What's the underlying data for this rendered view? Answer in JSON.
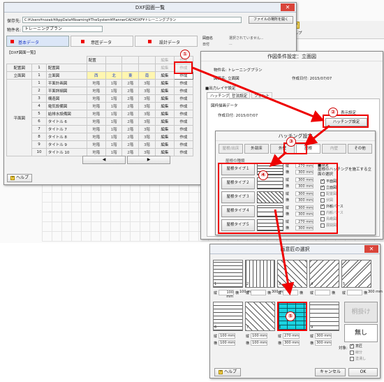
{
  "dxf_window": {
    "title": "DXF図面一覧",
    "save_to_label": "保存先:",
    "save_to_value": "C:¥Users¥nozaki¥AppData¥Roaming¥TheSystem¥PlannerCAD¥DXF¥トレーニングプラン",
    "property_label": "物件名:",
    "property_value": "トレーニングプラン",
    "open_folder_button": "ファイルの場所を開く",
    "tabs": [
      "基本データ",
      "意匠データ",
      "設計データ"
    ],
    "list_title": "【DXF図面一覧】",
    "side_info": {
      "drawing_label": "図面名",
      "drawing_value": "選択されていません...",
      "date_label": "日付",
      "date_value": "..."
    },
    "groups": [
      {
        "name": "配置図",
        "row_no": "1",
        "row_name": "配置図"
      },
      {
        "name": "立面図",
        "row_no": "1",
        "row_name": "立面図"
      }
    ],
    "elevation_headers": [
      "西",
      "北",
      "東",
      "南"
    ],
    "plan_group": "平面図",
    "plan_rows": [
      {
        "no": "1",
        "name": "平面計画図"
      },
      {
        "no": "2",
        "name": "平面詳細図"
      },
      {
        "no": "3",
        "name": "構造図"
      },
      {
        "no": "4",
        "name": "電気設備図"
      },
      {
        "no": "5",
        "name": "給排水設備図"
      },
      {
        "no": "6",
        "name": "タイトル 6"
      },
      {
        "no": "7",
        "name": "タイトル 7"
      },
      {
        "no": "8",
        "name": "タイトル 8"
      },
      {
        "no": "9",
        "name": "タイトル 9"
      },
      {
        "no": "10",
        "name": "タイトル 10"
      }
    ],
    "floor_cells": [
      "地階",
      "1階",
      "2階",
      "3階"
    ],
    "header_placement": "配置",
    "edit_label": "編集",
    "create_label": "作成",
    "prev_label": "◀",
    "next_label": "▶",
    "help_label": "ヘルプ"
  },
  "cad_toolbar": {
    "help": "ヘルプ"
  },
  "condition_window": {
    "title": "作図条件設定：立面図",
    "property_label": "物件名: トレーニングプラン",
    "drawing_label": "図面名: 立面図",
    "created_label": "作成日付: 2015/07/07",
    "output_layer_label": "■出力レイヤ設定",
    "tabs": [
      "ハッチング",
      "寸法設定",
      "フォント"
    ],
    "target_label": "図枠描画データ",
    "target_date": "作成日付: 2015/07/07",
    "display_setting": "表示設定",
    "hatching_button": "ハッチング設定"
  },
  "hatching_window": {
    "title": "ハッチング設定",
    "tabs": [
      "屋根/出床",
      "外部床",
      "外壁",
      "屋根",
      "内壁",
      "その他"
    ],
    "selected_tab": "屋根",
    "group_label": "屋根の種類",
    "types": [
      "屋根タイプ１",
      "屋根タイプ２",
      "屋根タイプ３",
      "屋根タイプ４",
      "屋根タイプ５"
    ],
    "dims": [
      {
        "v": "縦",
        "vv": "270 mm",
        "h": "横",
        "hv": "300 mm"
      },
      {
        "v": "縦",
        "vv": "300 mm",
        "h": "横",
        "hv": "300 mm"
      },
      {
        "v": "縦",
        "vv": "300 mm",
        "h": "横",
        "hv": "300 mm"
      },
      {
        "v": "縦",
        "vv": "300 mm",
        "h": "横",
        "hv": "300 mm"
      },
      {
        "v": "縦",
        "vv": "270 mm",
        "h": "横",
        "hv": "300 mm"
      }
    ],
    "settings_title": "■設定",
    "settings_desc": "屋根のハッチングを施工する立面の選択",
    "options": [
      {
        "label": "平面図",
        "checked": true
      },
      {
        "label": "立面図",
        "checked": true
      },
      {
        "label": "配置図",
        "checked": false
      },
      {
        "label": "伏図",
        "checked": false
      },
      {
        "label": "外観パース",
        "checked": true
      },
      {
        "label": "内観パース",
        "checked": false
      },
      {
        "label": "鳥瞰図",
        "checked": false
      },
      {
        "label": "展開図",
        "checked": false
      }
    ]
  },
  "pattern_window": {
    "title": "画意匠の選択",
    "row1_nums": [
      "1",
      "2",
      "3",
      "4",
      "5"
    ],
    "row1_dims": [
      {
        "v": "100 mm",
        "h": "100 mm"
      },
      {
        "v": "",
        "h": "300 mm"
      },
      {
        "v": "",
        "h": ""
      },
      {
        "v": "",
        "h": ""
      },
      {
        "v": "",
        "h": "300 mm"
      }
    ],
    "row2_nums": [
      "6",
      "7",
      "8",
      "9"
    ],
    "row2_dims": [
      {
        "v": "100 mm",
        "h": "100 mm"
      },
      {
        "v": "100 mm",
        "h": "100 mm"
      },
      {
        "v": "270 mm",
        "h": "300 mm"
      },
      {
        "v": "300 mm",
        "h": "300 mm"
      }
    ],
    "v_label": "縦",
    "h_label": "横",
    "grid_button": "桐掛け",
    "none_button": "無し",
    "target_label": "対象:",
    "target_opts": [
      {
        "label": "意匠",
        "checked": true
      },
      {
        "label": "線分",
        "checked": false
      },
      {
        "label": "塗潰し",
        "checked": false
      }
    ],
    "help_label": "ヘルプ",
    "cancel_label": "キャンセル",
    "ok_label": "OK"
  },
  "callouts": [
    "①",
    "②",
    "③",
    "④",
    "⑤"
  ],
  "colors": {
    "accent_red": "#e00000",
    "selected_tile": "#19d3e0"
  }
}
